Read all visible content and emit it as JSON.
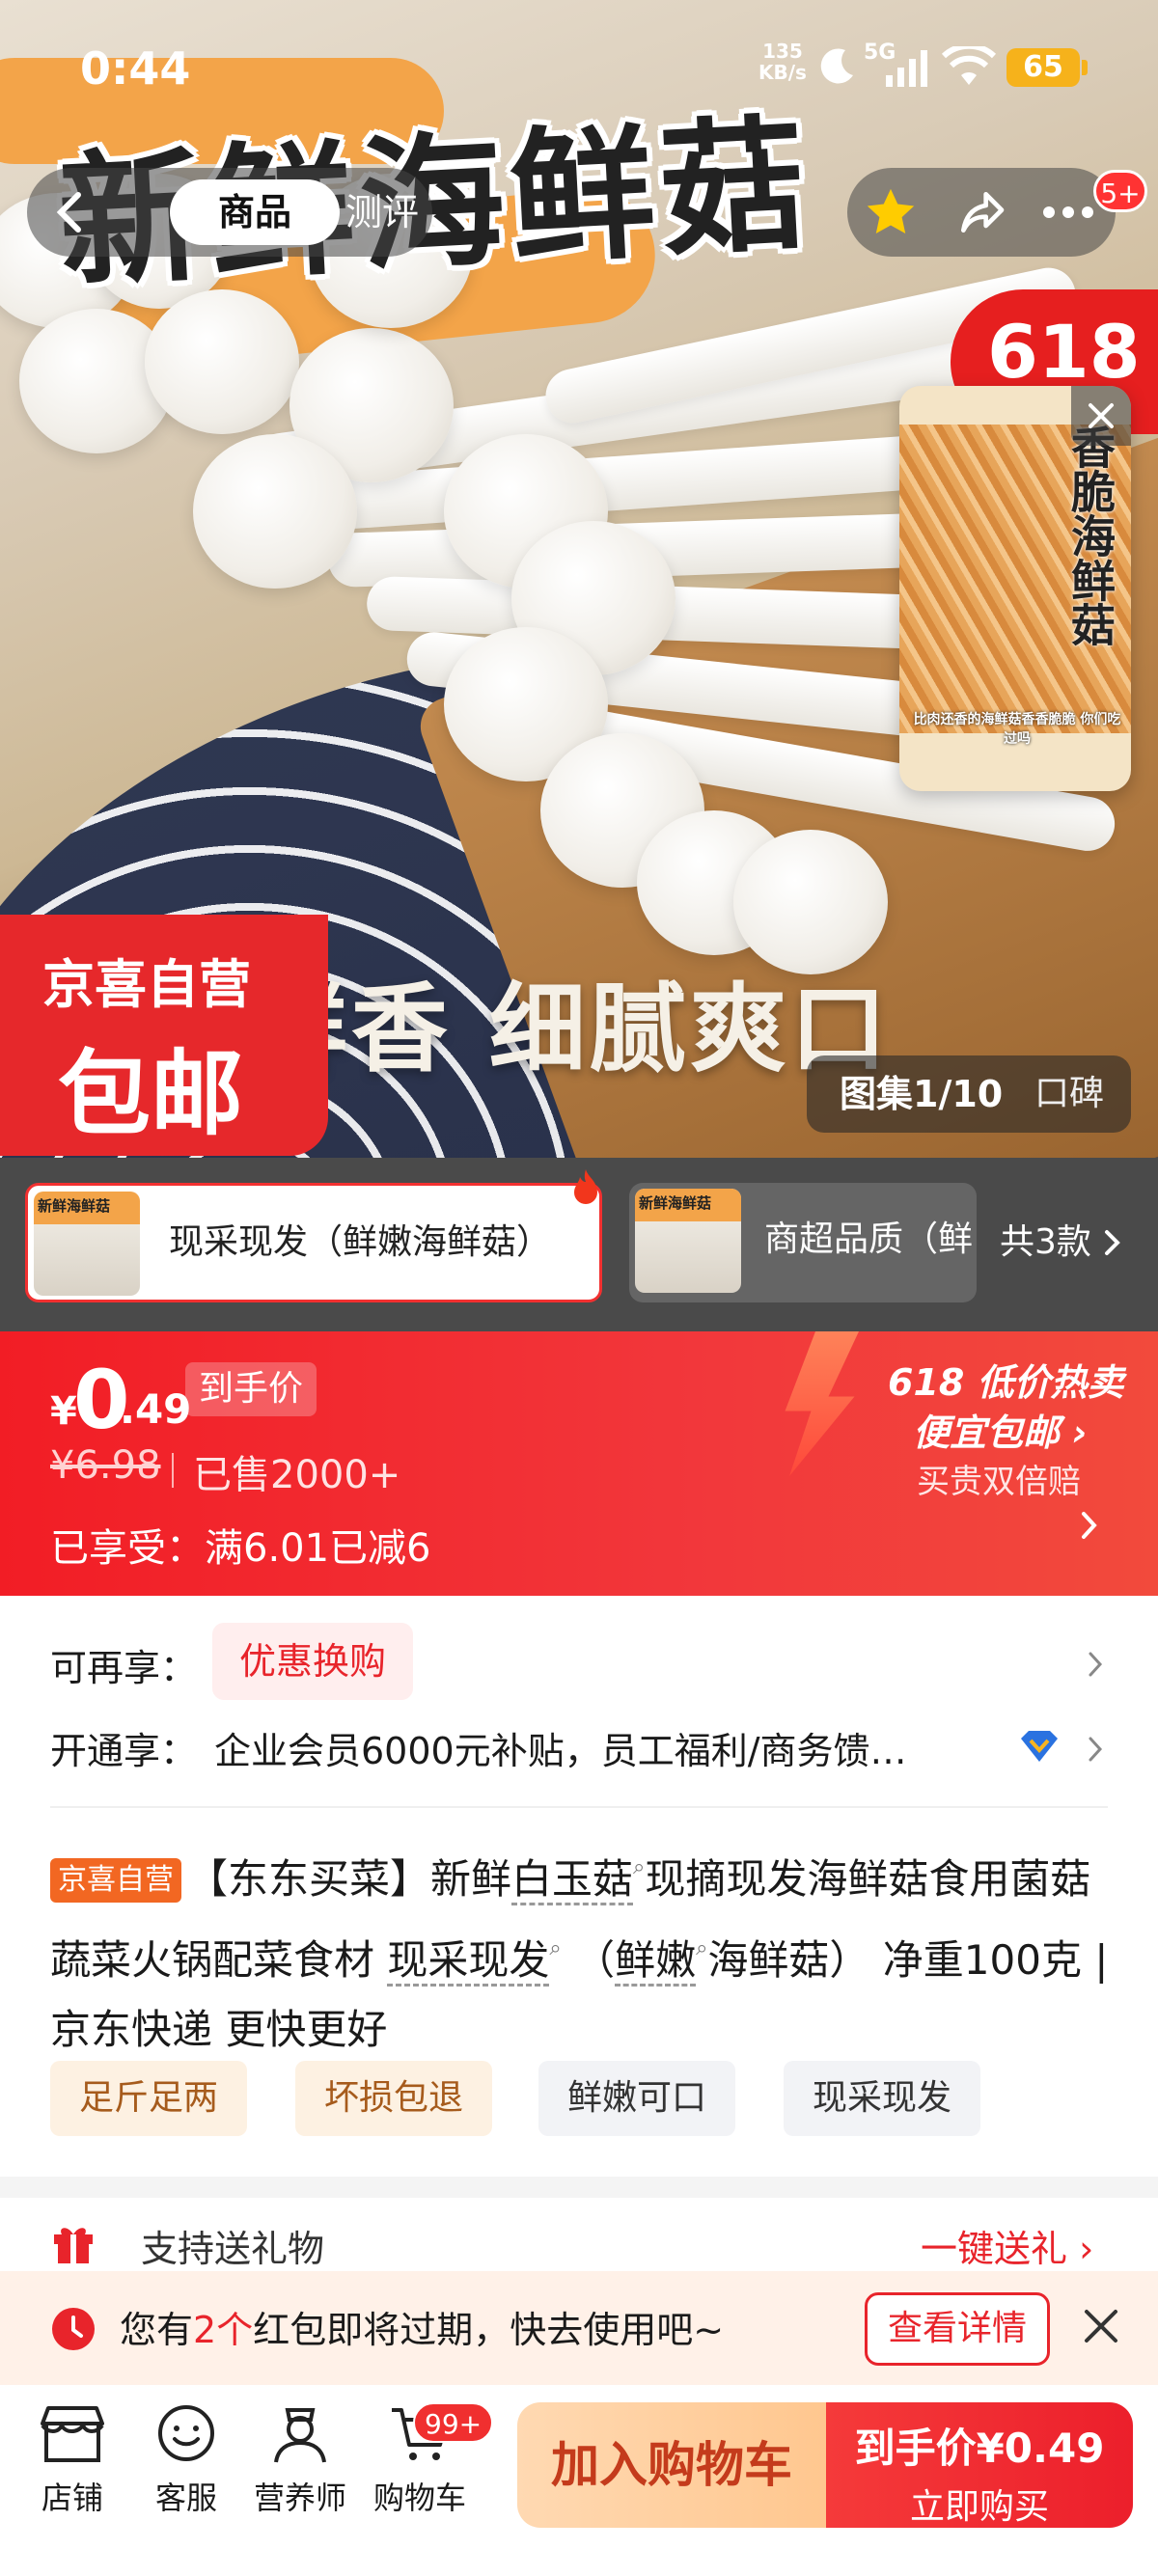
{
  "status_bar": {
    "time": "0:44",
    "net_speed_value": "135",
    "net_speed_unit": "KB/s",
    "network": "5G",
    "battery": "65"
  },
  "nav": {
    "tab_product": "商品",
    "tab_review": "测评",
    "badge": "5+"
  },
  "hero": {
    "title": "新鲜海鲜菇",
    "caption": "鲜香  细腻爽口",
    "sticker": "618",
    "badge_top": "京喜自营",
    "badge_bottom": "包邮",
    "gallery_index": "图集1/10",
    "gallery_reputation": "口碑"
  },
  "float_card": {
    "title": "香脆海鲜菇",
    "caption": "比肉还香的海鲜菇香香脆脆 你们吃过吗"
  },
  "variants": {
    "items": [
      {
        "thumb_text": "新鲜海鲜菇",
        "label": "现采现发（鲜嫩海鲜菇）"
      },
      {
        "thumb_text": "新鲜海鲜菇",
        "label": "商超品质（鲜"
      }
    ],
    "count": "共3款"
  },
  "price": {
    "symbol": "¥",
    "integer": "0",
    "decimal": ".49",
    "tag": "到手价",
    "original": "¥6.98",
    "sold": "已售2000+",
    "discount": "已享受：满6.01已减6",
    "promo_line1": "618 低价热卖",
    "promo_line2": "便宜包邮 ›",
    "promo_line3": "买贵双倍赔"
  },
  "info": {
    "extra_label": "可再享：",
    "exchange": "优惠换购",
    "open_label": "开通享：",
    "open_value": "企业会员6000元补贴，员工福利/商务馈…"
  },
  "title": {
    "tag": "京喜自营",
    "p1": "【东东买菜】新鲜",
    "kw1": "白玉菇",
    "p2": "现摘现发海鲜菇食用菌菇蔬菜火锅配菜食材 ",
    "kw2": "现采现发",
    "p3": "（",
    "kw3": "鲜嫩",
    "p4": "海鲜菇） 净重100克 | 京东快递 更快更好"
  },
  "tags": [
    "足斤足两",
    "坏损包退",
    "鲜嫩可口",
    "现采现发"
  ],
  "gift": {
    "label": "支持送礼物",
    "action": "一键送礼 ›"
  },
  "coupon": {
    "pre": "您有",
    "count": "2个",
    "post": "红包即将过期，快去使用吧~",
    "button": "查看详情"
  },
  "bottom_bar": {
    "shop": "店铺",
    "service": "客服",
    "nutritionist": "营养师",
    "cart": "购物车",
    "cart_badge": "99+",
    "add_cart": "加入购物车",
    "buy_price": "到手价¥0.49",
    "buy_now": "立即购买"
  },
  "colors": {
    "accent": "#e8242b",
    "brand_orange": "#f26722",
    "battery": "#f6b21b"
  }
}
